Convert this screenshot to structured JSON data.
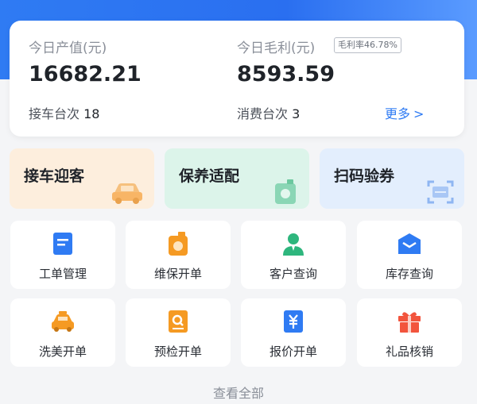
{
  "stats": {
    "output_label": "今日产值(元)",
    "output_value": "16682.21",
    "profit_label": "今日毛利(元)",
    "margin_badge": "毛利率46.78%",
    "profit_value": "8593.59",
    "pickup_label": "接车台次",
    "pickup_count": "18",
    "consume_label": "消费台次",
    "consume_count": "3",
    "more_label": "更多",
    "more_chevron": ">"
  },
  "quick_actions": [
    {
      "label": "接车迎客",
      "icon": "car-icon",
      "bg": "#fdeedd",
      "accent": "#f8c98f"
    },
    {
      "label": "保养适配",
      "icon": "oil-can-icon",
      "bg": "#dcf4ea",
      "accent": "#7fd0ad"
    },
    {
      "label": "扫码验券",
      "icon": "scan-icon",
      "bg": "#e3eefd",
      "accent": "#8fb6f2"
    }
  ],
  "grid": [
    {
      "label": "工单管理",
      "icon": "work-order-icon"
    },
    {
      "label": "维保开单",
      "icon": "maintenance-order-icon"
    },
    {
      "label": "客户查询",
      "icon": "customer-icon"
    },
    {
      "label": "库存查询",
      "icon": "inventory-icon"
    },
    {
      "label": "洗美开单",
      "icon": "car-wash-icon"
    },
    {
      "label": "预检开单",
      "icon": "precheck-icon"
    },
    {
      "label": "报价开单",
      "icon": "quote-icon"
    },
    {
      "label": "礼品核销",
      "icon": "gift-icon"
    }
  ],
  "view_all": "查看全部",
  "colors": {
    "primary": "#2f7bf3",
    "orange": "#f59a23",
    "green": "#2eb67d",
    "red": "#f2543d"
  }
}
